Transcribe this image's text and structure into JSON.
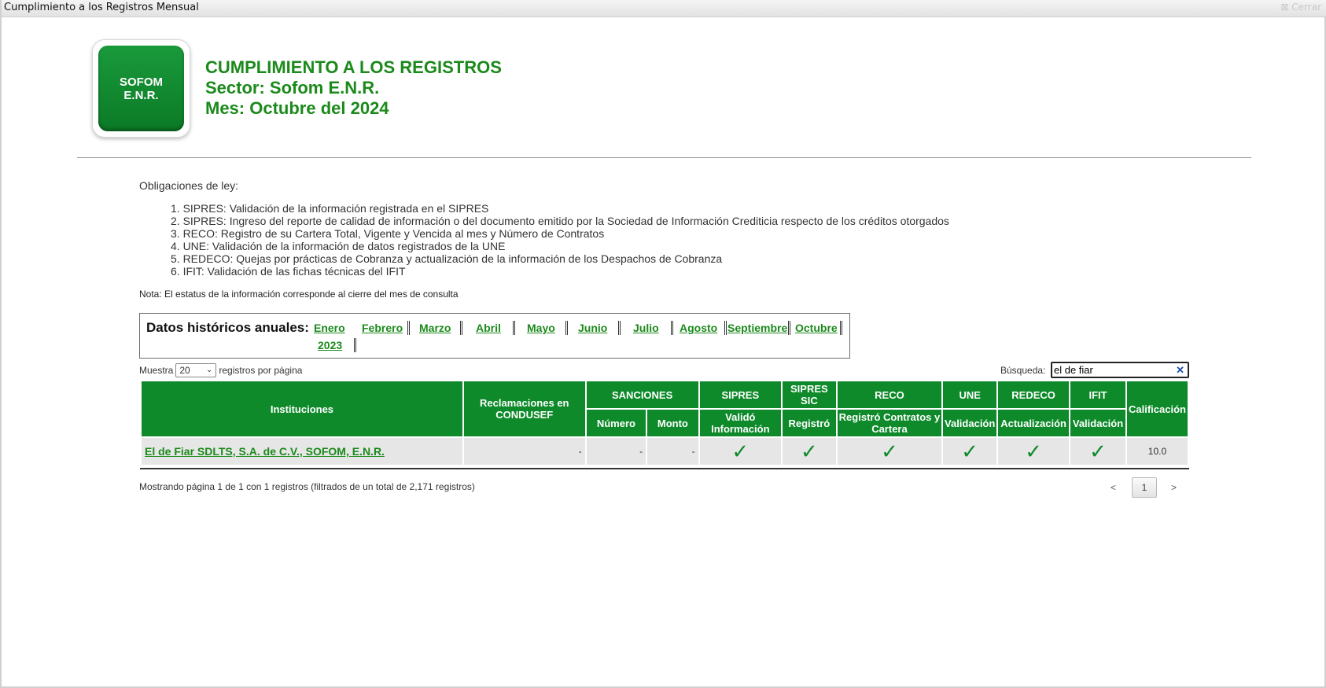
{
  "window": {
    "title": "Cumplimiento a los Registros Mensual",
    "close_label": "⊠ Cerrar"
  },
  "logo": {
    "line1": "SOFOM",
    "line2": "E.N.R."
  },
  "header": {
    "title": "CUMPLIMIENTO A LOS REGISTROS",
    "sector": "Sector: Sofom E.N.R.",
    "month": "Mes: Octubre del 2024"
  },
  "obligations": {
    "title": "Obligaciones de ley:",
    "items": [
      "1. SIPRES: Validación de la información registrada en el SIPRES",
      "2. SIPRES: Ingreso del reporte de calidad de información o del documento emitido por la Sociedad de Información Crediticia respecto de los créditos otorgados",
      "3. RECO: Registro de su Cartera Total, Vigente y Vencida al mes y Número de Contratos",
      "4. UNE: Validación de la información de datos registrados de la UNE",
      "5. REDECO: Quejas por prácticas de Cobranza y actualización de la información de los Despachos de Cobranza",
      "6. IFIT: Validación de las fichas técnicas del IFIT"
    ],
    "note": "Nota: El estatus de la información corresponde al cierre del mes de consulta"
  },
  "historical": {
    "label": "Datos históricos anuales:",
    "months": [
      "Enero",
      "Febrero",
      "Marzo",
      "Abril",
      "Mayo",
      "Junio",
      "Julio",
      "Agosto",
      "Septiembre",
      "Octubre"
    ],
    "year": "2023"
  },
  "controls": {
    "show_prefix": "Muestra",
    "page_size": "20",
    "show_suffix": "registros por página",
    "search_label": "Búsqueda:",
    "search_value": "el de fiar",
    "clear_symbol": "✕"
  },
  "table": {
    "headers": {
      "instituciones": "Instituciones",
      "reclamaciones": "Reclamaciones en CONDUSEF",
      "sanciones": "SANCIONES",
      "sipres": "SIPRES",
      "sipres_sic": "SIPRES SIC",
      "reco": "RECO",
      "une": "UNE",
      "redeco": "REDECO",
      "ifit": "IFIT",
      "calificacion": "Calificación",
      "numero": "Número",
      "monto": "Monto",
      "valido_info": "Validó Información",
      "registro": "Registró",
      "registro_contratos": "Registró Contratos y Cartera",
      "validacion_une": "Validación",
      "actualizacion": "Actualización",
      "validacion_ifit": "Validación"
    },
    "rows": [
      {
        "institucion": "El de Fiar SDLTS, S.A. de C.V., SOFOM, E.N.R.",
        "reclamaciones": "-",
        "numero": "-",
        "monto": "-",
        "check": "✓",
        "calificacion": "10.0"
      }
    ]
  },
  "footer": {
    "showing": "Mostrando página 1 de 1 con 1 registros (filtrados de un total de 2,171 registros)",
    "prev": "<",
    "current_page": "1",
    "next": ">"
  },
  "colors": {
    "accent_green": "#0e8a2a",
    "title_green": "#1b8a1b"
  }
}
